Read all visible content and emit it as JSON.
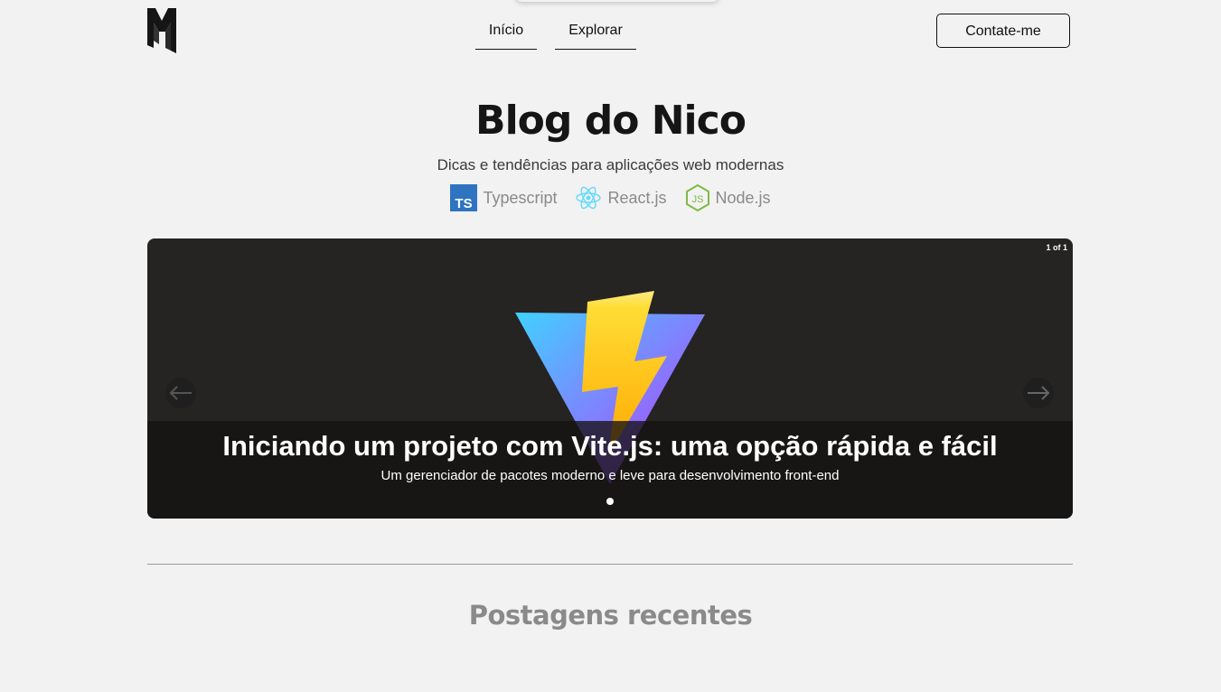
{
  "nav": {
    "logo_icon": "m-monogram-logo-icon",
    "links": [
      {
        "label": "Início"
      },
      {
        "label": "Explorar"
      }
    ],
    "contact_label": "Contate-me"
  },
  "hero": {
    "title": "Blog do Nico",
    "subtitle": "Dicas e tendências para aplicações web modernas",
    "tags": [
      {
        "label": "Typescript",
        "icon": "typescript-icon",
        "color": "#2f74c0"
      },
      {
        "label": "React.js",
        "icon": "react-icon",
        "color": "#61dafb"
      },
      {
        "label": "Node.js",
        "icon": "nodejs-icon",
        "color": "#7fba44"
      }
    ]
  },
  "carousel": {
    "counter": "1 of 1",
    "slides": [
      {
        "image_icon": "vite-logo-icon",
        "title": "Iniciando um projeto com Vite.js: uma opção rápida e fácil",
        "description": "Um gerenciador de pacotes moderno e leve para desenvolvimento front-end"
      }
    ],
    "active_slide": 1,
    "prev_icon": "arrow-left-icon",
    "next_icon": "arrow-right-icon"
  },
  "recent": {
    "title": "Postagens recentes"
  },
  "colors": {
    "background": "#f2f2f2",
    "carousel_bg": "#262323",
    "text": "#111111",
    "muted": "#8a8a8a"
  }
}
